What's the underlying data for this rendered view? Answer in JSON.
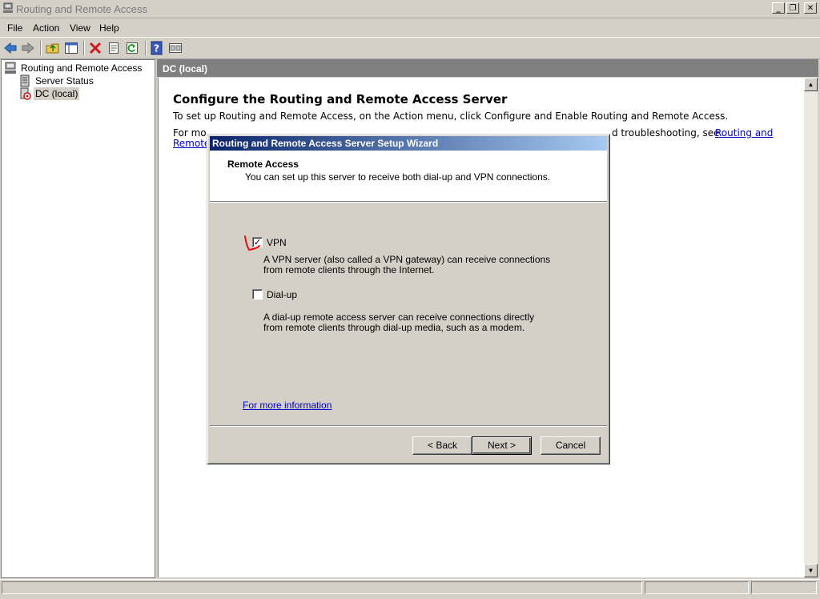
{
  "window": {
    "title": "Routing and Remote Access",
    "controls": {
      "minimize": "_",
      "restore": "❐",
      "close": "✕"
    }
  },
  "menu": [
    "File",
    "Action",
    "View",
    "Help"
  ],
  "toolbar": {
    "icons": [
      "back-icon",
      "forward-icon",
      "up-folder-icon",
      "show-hide-tree-icon",
      "delete-icon",
      "properties-icon",
      "refresh-icon",
      "help-icon",
      "console-tree-icon"
    ]
  },
  "tree": {
    "root": "Routing and Remote Access",
    "items": [
      {
        "label": "Server Status"
      },
      {
        "label": "DC (local)"
      }
    ]
  },
  "pane": {
    "header": "DC (local)",
    "heading": "Configure the Routing and Remote Access Server",
    "line1": "To set up Routing and Remote Access, on the Action menu, click Configure and Enable Routing and Remote Access.",
    "line2_prefix": "For mo",
    "line2_visible_tail": "d troubleshooting, see",
    "link_part1": "Routing and",
    "link_part2": "Remote"
  },
  "dialog": {
    "title": "Routing and Remote Access Server Setup Wizard",
    "header_title": "Remote Access",
    "header_subtitle": "You can set up this server to receive both dial-up and VPN connections.",
    "options": [
      {
        "label": "VPN",
        "checked": true,
        "description": "A VPN server (also called a VPN gateway) can receive connections from remote clients through the Internet."
      },
      {
        "label": "Dial-up",
        "checked": false,
        "description": "A dial-up remote access server can receive connections directly from remote clients through dial-up media, such as a modem."
      }
    ],
    "more_info_link": "For more information",
    "buttons": {
      "back": "< Back",
      "next": "Next >",
      "cancel": "Cancel"
    }
  },
  "colors": {
    "chrome": "#d4d0c8",
    "header_gray": "#808080",
    "dialog_title_start": "#0a246a",
    "dialog_title_end": "#a6caf0",
    "link": "#0000cc",
    "annotation_red": "#e01010"
  }
}
